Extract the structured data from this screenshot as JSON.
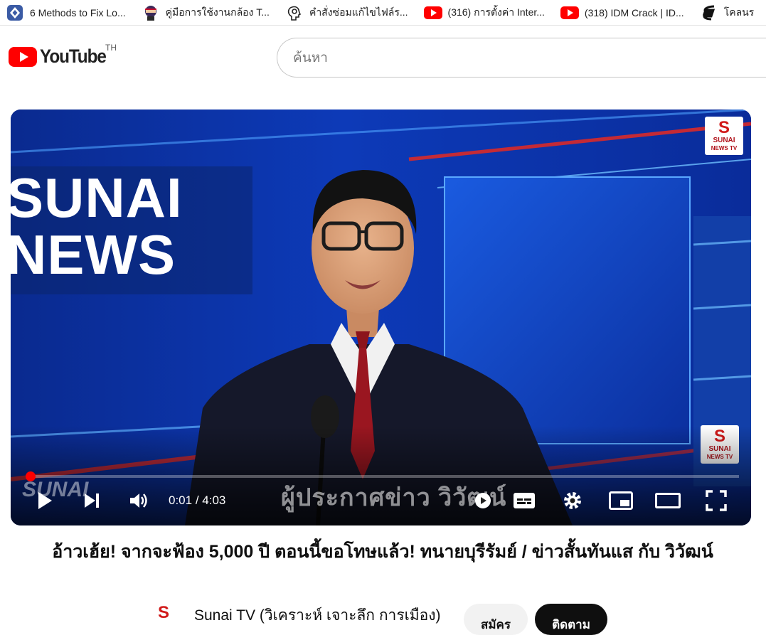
{
  "bookmarks": [
    {
      "label": "6 Methods to Fix Lo...",
      "icon": "diamond-app-icon"
    },
    {
      "label": "คู่มือการใช้งานกล้อง T...",
      "icon": "ninja-avatar-icon"
    },
    {
      "label": "คำสั่งซ่อมแก้ไขไฟล์ร...",
      "icon": "head-gear-icon"
    },
    {
      "label": "(316) การตั้งค่า Inter...",
      "icon": "youtube-icon"
    },
    {
      "label": "(318) IDM Crack | ID...",
      "icon": "youtube-icon"
    },
    {
      "label": "โคลนร",
      "icon": "stylized-e-icon"
    }
  ],
  "header": {
    "logo_text": "YouTube",
    "region": "TH",
    "search_placeholder": "ค้นหา"
  },
  "player": {
    "brand_line1": "SUNAI",
    "brand_line2": "NEWS",
    "corner_logo_s": "S",
    "corner_logo_name": "SUNAI",
    "corner_logo_sub": "NEWS TV",
    "watermark_left": "SUNAI",
    "subtitle": "ผู้ประกาศข่าว วิวัฒน์",
    "current_time": "0:01",
    "time_separator": "/",
    "duration": "4:03",
    "progress_fraction": 0.004,
    "colors": {
      "progress": "#ff0000",
      "studio_blue": "#0b2a8c",
      "accent_red": "#d11a1a"
    }
  },
  "video": {
    "title": "อ้าวเฮ้ย! จากจะฟ้อง 5,000 ปี ตอนนี้ขอโทษแล้ว! ทนายบุรีรัมย์ / ข่าวสั้นทันแส กับ วิวัฒน์"
  },
  "channel": {
    "avatar_s": "S",
    "name": "Sunai TV (วิเคราะห์ เจาะลึก การเมือง)",
    "join_label": "สมัคร",
    "subscribe_label": "ติดตาม"
  }
}
